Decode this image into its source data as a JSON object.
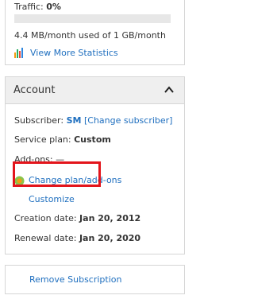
{
  "traffic": {
    "label": "Traffic:",
    "value": "0%",
    "usage_text": "4.4 MB/month used of 1 GB/month",
    "usage_fraction": 0,
    "more_stats_link": "View More Statistics",
    "stats_icon": "bar-chart-icon"
  },
  "account": {
    "title": "Account",
    "collapse_icon": "chevron-up-icon",
    "subscriber_label": "Subscriber:",
    "subscriber_value": "SM",
    "change_subscriber_link": "[Change subscriber]",
    "service_plan_label": "Service plan:",
    "service_plan_value": "Custom",
    "addons_label": "Add-ons:",
    "addons_value": "—",
    "change_plan_link": "Change plan/add-ons",
    "change_plan_icon": "puzzle-icon",
    "customize_link": "Customize",
    "creation_date_label": "Creation date:",
    "creation_date_value": "Jan 20, 2012",
    "renewal_date_label": "Renewal date:",
    "renewal_date_value": "Jan 20, 2020"
  },
  "remove_subscription": {
    "label": "Remove Subscription"
  },
  "colors": {
    "link": "#1f6fbf",
    "highlight": "#e3141b",
    "header_bg": "#efefef",
    "border": "#d6d6d6"
  }
}
